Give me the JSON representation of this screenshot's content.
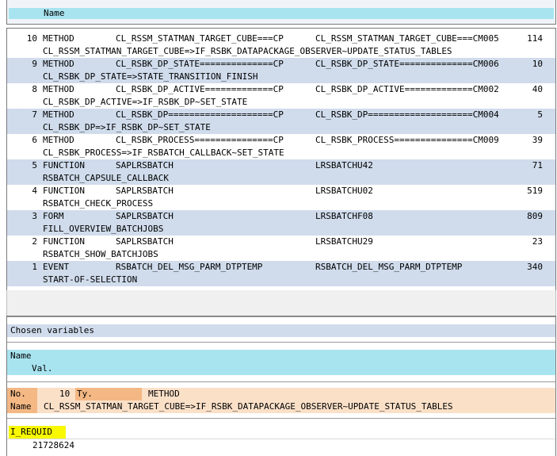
{
  "top_header": {
    "label": "Name"
  },
  "call_stack": [
    {
      "num": "10",
      "type": "METHOD",
      "program": "CL_RSSM_STATMAN_TARGET_CUBE===CP",
      "include": "CL_RSSM_STATMAN_TARGET_CUBE===CM005",
      "line": "114",
      "event": "CL_RSSM_STATMAN_TARGET_CUBE=>IF_RSBK_DATAPACKAGE_OBSERVER~UPDATE_STATUS_TABLES"
    },
    {
      "num": "9",
      "type": "METHOD",
      "program": "CL_RSBK_DP_STATE==============CP",
      "include": "CL_RSBK_DP_STATE==============CM006",
      "line": "10",
      "event": "CL_RSBK_DP_STATE=>STATE_TRANSITION_FINISH"
    },
    {
      "num": "8",
      "type": "METHOD",
      "program": "CL_RSBK_DP_ACTIVE=============CP",
      "include": "CL_RSBK_DP_ACTIVE=============CM002",
      "line": "40",
      "event": "CL_RSBK_DP_ACTIVE=>IF_RSBK_DP~SET_STATE"
    },
    {
      "num": "7",
      "type": "METHOD",
      "program": "CL_RSBK_DP====================CP",
      "include": "CL_RSBK_DP====================CM004",
      "line": "5",
      "event": "CL_RSBK_DP=>IF_RSBK_DP~SET_STATE"
    },
    {
      "num": "6",
      "type": "METHOD",
      "program": "CL_RSBK_PROCESS===============CP",
      "include": "CL_RSBK_PROCESS===============CM009",
      "line": "39",
      "event": "CL_RSBK_PROCESS=>IF_RSBATCH_CALLBACK~SET_STATE"
    },
    {
      "num": "5",
      "type": "FUNCTION",
      "program": "SAPLRSBATCH",
      "include": "LRSBATCHU42",
      "line": "71",
      "event": "RSBATCH_CAPSULE_CALLBACK"
    },
    {
      "num": "4",
      "type": "FUNCTION",
      "program": "SAPLRSBATCH",
      "include": "LRSBATCHU02",
      "line": "519",
      "event": "RSBATCH_CHECK_PROCESS"
    },
    {
      "num": "3",
      "type": "FORM",
      "program": "SAPLRSBATCH",
      "include": "LRSBATCHF08",
      "line": "809",
      "event": "FILL_OVERVIEW_BATCHJOBS"
    },
    {
      "num": "2",
      "type": "FUNCTION",
      "program": "SAPLRSBATCH",
      "include": "LRSBATCHU29",
      "line": "23",
      "event": "RSBATCH_SHOW_BATCHJOBS"
    },
    {
      "num": "1",
      "type": "EVENT",
      "program": "RSBATCH_DEL_MSG_PARM_DTPTEMP",
      "include": "RSBATCH_DEL_MSG_PARM_DTPTEMP",
      "line": "340",
      "event": "START-OF-SELECTION"
    }
  ],
  "variables": {
    "title": "Chosen variables",
    "header_name": "Name",
    "header_val": "Val.",
    "no_label": "No.",
    "no_value": "10",
    "ty_label": "Ty.",
    "ty_value": "METHOD",
    "name_label": "Name",
    "name_value": "CL_RSSM_STATMAN_TARGET_CUBE=>IF_RSBK_DATAPACKAGE_OBSERVER~UPDATE_STATUS_TABLES",
    "var_name": "I_REQUID",
    "var_value": "21728624"
  },
  "colors": {
    "header_cyan": "#a8e4f0",
    "alt_row_blue": "#d0dcec",
    "detail_peach": "#fbe0c8",
    "label_orange": "#f4b884",
    "highlight_yellow": "#f8f800"
  }
}
